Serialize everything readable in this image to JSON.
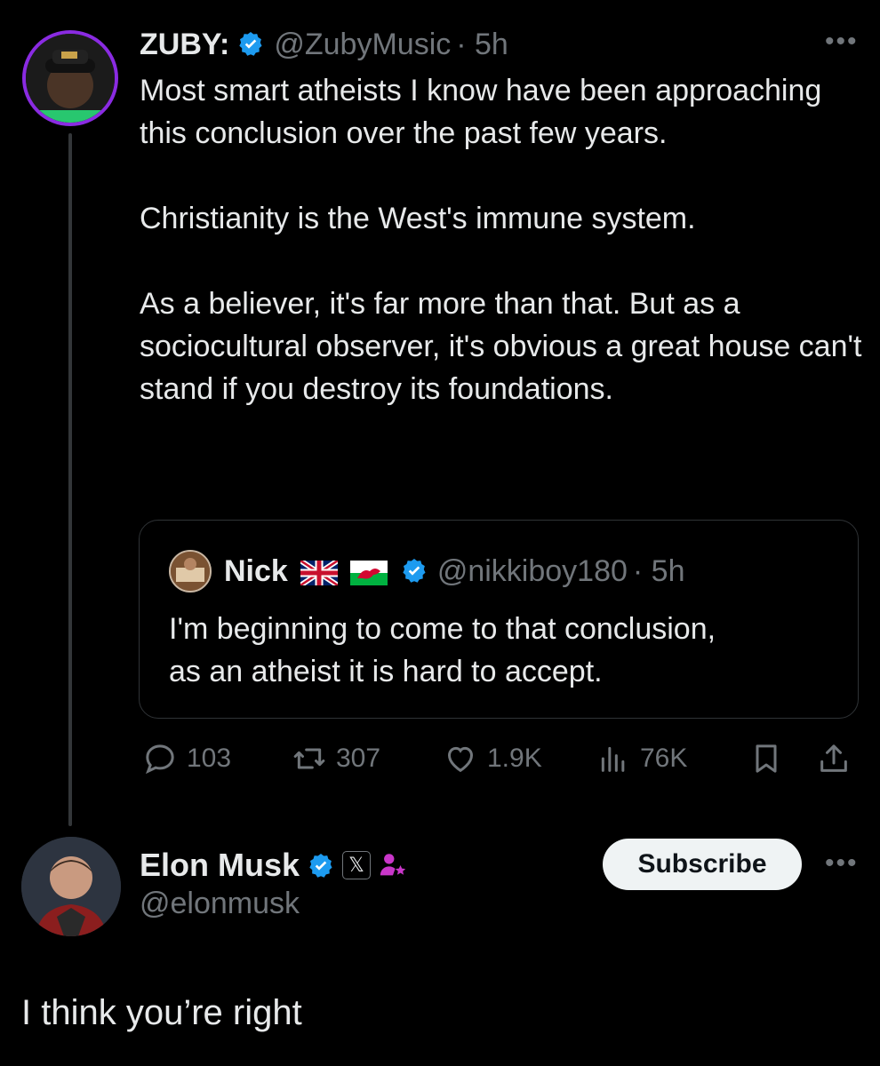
{
  "tweet": {
    "author_name": "ZUBY:",
    "handle": "@ZubyMusic",
    "time": "· 5h",
    "more_icon": "•••",
    "paragraphs": [
      "Most smart atheists I know have been approaching this conclusion over the past few years.",
      "Christianity is the West's immune system.",
      "As a believer, it's far more than that. But as a sociocultural observer, it's obvious a great house can't stand if you destroy its foundations."
    ],
    "quote": {
      "author_name": "Nick",
      "flags": [
        "uk-flag",
        "wales-flag"
      ],
      "handle": "@nikkiboy180",
      "time": "· 5h",
      "text_line1": "I'm beginning to come to that conclusion,",
      "text_line2": "as an atheist it is hard to accept."
    },
    "actions": {
      "replies": "103",
      "reposts": "307",
      "likes": "1.9K",
      "views": "76K"
    }
  },
  "reply": {
    "author_name": "Elon Musk",
    "x_badge": "𝕏",
    "handle": "@elonmusk",
    "subscribe_label": "Subscribe",
    "more_icon": "•••",
    "text": "I think you’re right"
  },
  "colors": {
    "background": "#000000",
    "text": "#e7e9ea",
    "secondary": "#71767b",
    "verified": "#1d9bf0",
    "avatar_ring": "#8a2be2"
  }
}
